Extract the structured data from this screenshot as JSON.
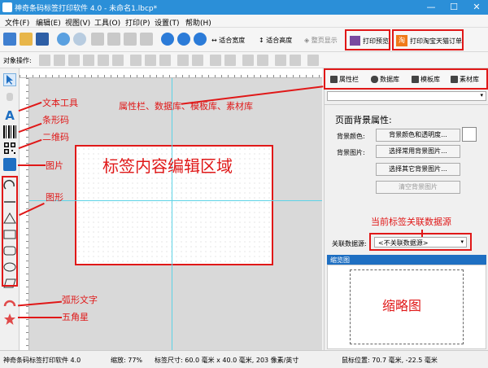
{
  "window": {
    "title": "神奇条码标签打印软件 4.0 - 未命名1.lbcp*",
    "minimize": "—",
    "maximize": "☐",
    "close": "✕"
  },
  "menu": [
    "文件(F)",
    "编辑(E)",
    "视图(V)",
    "工具(O)",
    "打印(P)",
    "设置(T)",
    "帮助(H)"
  ],
  "toolbar": {
    "fit_width": "适合宽度",
    "fit_height": "适合高度",
    "full_display": "整页显示",
    "print_preview": "打印预览",
    "print_taobao": "打印淘宝天猫订单"
  },
  "toolbar2": {
    "object_ops": "对象操作:"
  },
  "panel": {
    "tabs": [
      "属性栏",
      "数据库",
      "模板库",
      "素材库"
    ],
    "section_title": "页面背景属性:",
    "bg_color_label": "背景颜色:",
    "bg_color_button": "背景颜色和透明度...",
    "bg_image_label": "背景图片:",
    "choose_common_bg": "选择常用背景图片...",
    "choose_other_bg": "选择其它背景图片...",
    "clear_bg": "清空背景图片",
    "linked_source_label": "关联数据源:",
    "linked_source_value": "<不关联数据源>",
    "thumbnail_header": "缩览图"
  },
  "status": {
    "app": "神奇条码标签打印软件 4.0",
    "zoom": "缩放: 77%",
    "label_size": "标签尺寸: 60.0 毫米 x 40.0 毫米, 203 像素/英寸",
    "mouse_pos": "鼠标位置: 70.7 毫米, -22.5 毫米"
  },
  "annotations": {
    "text_tool": "文本工具",
    "barcode": "条形码",
    "qrcode": "二维码",
    "image": "图片",
    "shapes": "图形",
    "arc_text": "弧形文字",
    "star": "五角星",
    "panels": "属性栏、数据库、模板库、素材库",
    "edit_area": "标签内容编辑区域",
    "datasource_note": "当前标签关联数据源",
    "thumbnail": "缩略图"
  },
  "colors": {
    "title_bar": "#2b8fd8",
    "annotation": "#e01818",
    "thumbnail_bar": "#1e6fc2"
  }
}
